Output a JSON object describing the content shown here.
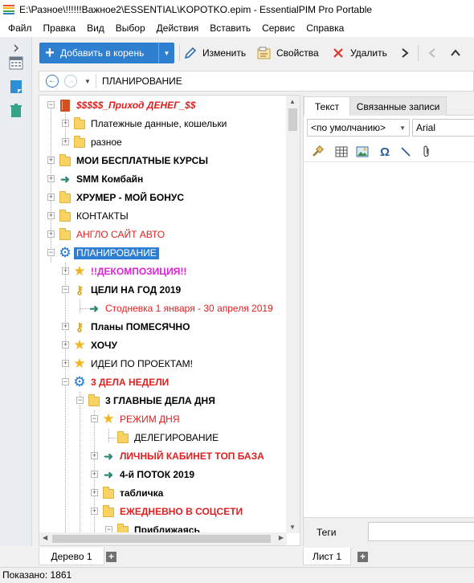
{
  "window": {
    "title": "E:\\Разное\\!!!!!!Важное2\\ESSENTIAL\\KOPOTKO.epim - EssentialPIM Pro Portable",
    "icon": "essentialpim-app-icon"
  },
  "menu": [
    {
      "label": "Файл"
    },
    {
      "label": "Правка"
    },
    {
      "label": "Вид"
    },
    {
      "label": "Выбор"
    },
    {
      "label": "Действия"
    },
    {
      "label": "Вставить"
    },
    {
      "label": "Сервис"
    },
    {
      "label": "Справка"
    }
  ],
  "left_dock": {
    "items": [
      {
        "icon": "chevron-right-icon"
      },
      {
        "icon": "calendar-icon"
      },
      {
        "icon": "notes-icon"
      },
      {
        "icon": "trash-icon"
      }
    ]
  },
  "toolbar": {
    "add_label": "Добавить в корень",
    "edit_label": "Изменить",
    "properties_label": "Свойства",
    "delete_label": "Удалить"
  },
  "nav": {
    "path": "ПЛАНИРОВАНИЕ"
  },
  "tree": {
    "rows": [
      {
        "label": "$$$$$_Приход ДЕНЕГ_$$",
        "icon": "book-icon",
        "style": "red bold-italic",
        "expander": "−"
      },
      {
        "label": "Платежные данные, кошельки",
        "icon": "folder-icon",
        "style": "normal",
        "expander": "+"
      },
      {
        "label": "разное",
        "icon": "folder-icon",
        "style": "normal",
        "expander": "+"
      },
      {
        "label": "МОИ БЕСПЛАТНЫЕ КУРСЫ",
        "icon": "folder-icon",
        "style": "bold",
        "expander": "+"
      },
      {
        "label": "SMM Комбайн",
        "icon": "arrow-right-icon",
        "style": "bold",
        "expander": "+"
      },
      {
        "label": "ХРУМЕР - МОЙ БОНУС",
        "icon": "folder-icon",
        "style": "bold",
        "expander": "+"
      },
      {
        "label": "КОНТАКТЫ",
        "icon": "folder-icon",
        "style": "normal",
        "expander": "+"
      },
      {
        "label": "АНГЛО САЙТ АВТО",
        "icon": "folder-icon",
        "style": "red",
        "expander": "+"
      },
      {
        "label": "ПЛАНИРОВАНИЕ",
        "icon": "gear-icon",
        "style": "selected",
        "expander": "−"
      },
      {
        "label": "!!ДЕКОМПОЗИЦИЯ!!",
        "icon": "star-icon",
        "style": "magenta bold",
        "expander": "+"
      },
      {
        "label": "ЦЕЛИ НА ГОД 2019",
        "icon": "key-icon",
        "style": "bold",
        "expander": "−"
      },
      {
        "label": "Стодневка 1 января - 30 апреля 2019",
        "icon": "arrow-right-icon",
        "style": "red",
        "expander": ""
      },
      {
        "label": "Планы ПОМЕСЯЧНО",
        "icon": "key-icon",
        "style": "bold",
        "expander": "+"
      },
      {
        "label": "ХОЧУ",
        "icon": "star-icon",
        "style": "bold",
        "expander": "+"
      },
      {
        "label": "ИДЕИ ПО ПРОЕКТАМ!",
        "icon": "star-icon",
        "style": "normal",
        "expander": "+"
      },
      {
        "label": "3 ДЕЛА НЕДЕЛИ",
        "icon": "gear-icon",
        "style": "red bold",
        "expander": "−"
      },
      {
        "label": "3 ГЛАВНЫЕ ДЕЛА ДНЯ",
        "icon": "folder-icon",
        "style": "bold",
        "expander": "−"
      },
      {
        "label": "РЕЖИМ ДНЯ",
        "icon": "star-icon",
        "style": "red",
        "expander": "−"
      },
      {
        "label": "ДЕЛЕГИРОВАНИЕ",
        "icon": "folder-icon",
        "style": "normal",
        "expander": ""
      },
      {
        "label": "ЛИЧНЫЙ КАБИНЕТ ТОП БАЗА",
        "icon": "arrow-right-icon",
        "style": "red bold",
        "expander": "+"
      },
      {
        "label": "4-й ПОТОК 2019",
        "icon": "arrow-right-icon",
        "style": "bold",
        "expander": "+"
      },
      {
        "label": "табличка",
        "icon": "folder-icon",
        "style": "bold",
        "expander": "+"
      },
      {
        "label": "ЕЖЕДНЕВНО В СОЦСЕТИ",
        "icon": "folder-icon",
        "style": "red bold",
        "expander": "+"
      },
      {
        "label": "Приближаясь",
        "icon": "folder-icon",
        "style": "bold",
        "expander": "−"
      }
    ],
    "bottom_tab": "Дерево 1"
  },
  "editor": {
    "tabs": [
      {
        "label": "Текст"
      },
      {
        "label": "Связанные записи"
      }
    ],
    "style_select": "<по умолчанию>",
    "font_select": "Arial",
    "tags_label": "Теги",
    "tags_value": "",
    "bottom_tab": "Лист 1"
  },
  "status": {
    "text": "Показано: 1861"
  },
  "colors": {
    "accent": "#2f7fd0",
    "selection": "#2e7ed3",
    "red_text": "#e02020",
    "magenta_text": "#e020d8",
    "folder": "#f8d262"
  }
}
